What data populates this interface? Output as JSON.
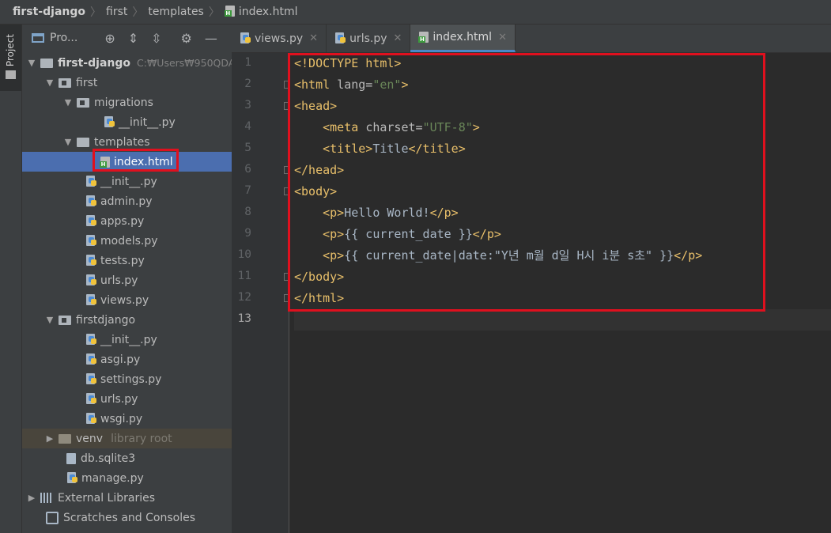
{
  "breadcrumb": {
    "items": [
      "first-django",
      "first",
      "templates",
      "index.html"
    ]
  },
  "side_strip": {
    "project_label": "Project"
  },
  "project_panel": {
    "title": "Pro...",
    "tree": [
      {
        "label": "first-django",
        "note": "C:₩Users₩950QDA",
        "bold": true
      },
      {
        "label": "first"
      },
      {
        "label": "migrations"
      },
      {
        "label": "__init__.py"
      },
      {
        "label": "templates"
      },
      {
        "label": "index.html"
      },
      {
        "label": "__init__.py"
      },
      {
        "label": "admin.py"
      },
      {
        "label": "apps.py"
      },
      {
        "label": "models.py"
      },
      {
        "label": "tests.py"
      },
      {
        "label": "urls.py"
      },
      {
        "label": "views.py"
      },
      {
        "label": "firstdjango"
      },
      {
        "label": "__init__.py"
      },
      {
        "label": "asgi.py"
      },
      {
        "label": "settings.py"
      },
      {
        "label": "urls.py"
      },
      {
        "label": "wsgi.py"
      },
      {
        "label": "venv",
        "note": "library root"
      },
      {
        "label": "db.sqlite3"
      },
      {
        "label": "manage.py"
      },
      {
        "label": "External Libraries"
      },
      {
        "label": "Scratches and Consoles"
      }
    ]
  },
  "tabs": [
    {
      "label": "views.py"
    },
    {
      "label": "urls.py"
    },
    {
      "label": "index.html",
      "active": true
    }
  ],
  "editor": {
    "line_numbers": [
      "1",
      "2",
      "3",
      "4",
      "5",
      "6",
      "7",
      "8",
      "9",
      "10",
      "11",
      "12",
      "13"
    ],
    "lines": {
      "l1": {
        "t1": "<!DOCTYPE html>"
      },
      "l2": {
        "t1": "<html ",
        "a1": "lang=",
        "s1": "\"en\"",
        "t2": ">"
      },
      "l3": {
        "t1": "<head>"
      },
      "l4": {
        "indent": "    ",
        "t1": "<meta ",
        "a1": "charset=",
        "s1": "\"UTF-8\"",
        "t2": ">"
      },
      "l5": {
        "indent": "    ",
        "t1": "<title>",
        "x1": "Title",
        "t2": "</title>"
      },
      "l6": {
        "t1": "</head>"
      },
      "l7": {
        "t1": "<body>"
      },
      "l8": {
        "indent": "    ",
        "t1": "<p>",
        "x1": "Hello World!",
        "t2": "</p>"
      },
      "l9": {
        "indent": "    ",
        "t1": "<p>",
        "x1": "{{ current_date }}",
        "t2": "</p>"
      },
      "l10": {
        "indent": "    ",
        "t1": "<p>",
        "x1": "{{ current_date|date:\"Y년 m월 d일 H시 i분 s초\" }}",
        "t2": "</p>"
      },
      "l11": {
        "t1": "</body>"
      },
      "l12": {
        "t1": "</html>"
      },
      "l13": {}
    }
  },
  "colors": {
    "annotation_red": "#e0101e",
    "selection_blue": "#4b6eaf",
    "tag_yellow": "#e8bf6a",
    "string_green": "#6a8759"
  }
}
